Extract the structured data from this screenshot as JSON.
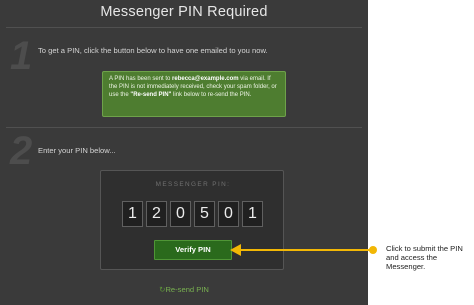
{
  "page": {
    "title": "Messenger PIN Required"
  },
  "step1": {
    "number": "1",
    "text": "To get a PIN, click the button below to have one emailed to you now."
  },
  "notice": {
    "part1": "A PIN has been sent to ",
    "email": "rebecca@example.com",
    "part2": " via email. If the PIN is not immediately received, check your spam folder, or use the ",
    "link": "\"Re-send PIN\"",
    "part3": " link below to re-send the PIN.",
    "bg_color": "#4e7d30"
  },
  "step2": {
    "number": "2",
    "text": "Enter your PIN below..."
  },
  "pin": {
    "label": "MESSENGER PIN:",
    "digits": [
      "1",
      "2",
      "0",
      "5",
      "0",
      "1"
    ]
  },
  "verify_button": {
    "label": "Verify PIN",
    "color": "#2a6a1c"
  },
  "resend": {
    "icon": "refresh-icon",
    "label": "Re-send PIN"
  },
  "callout": {
    "text": "Click to submit the PIN and access the Messenger.",
    "arrow_color": "#f2b705"
  }
}
